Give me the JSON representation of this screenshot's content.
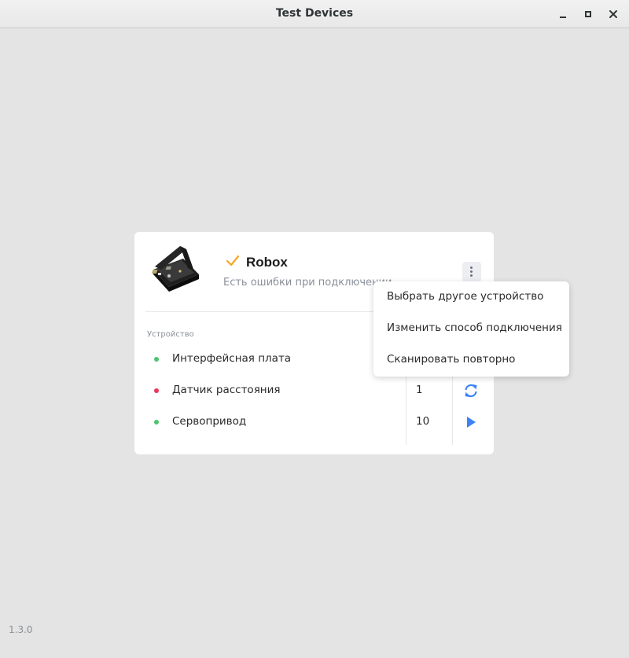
{
  "window": {
    "title": "Test Devices",
    "controls": [
      "minimize-icon",
      "maximize-icon",
      "close-icon"
    ]
  },
  "device": {
    "name": "Robox",
    "status": "Есть ошибки при подключении",
    "status_icon": "check-icon",
    "accent_color": "#f5a524"
  },
  "table": {
    "header": "Устройство",
    "rows": [
      {
        "name": "Интерфейсная плата",
        "status_color": "#4cc46b",
        "value": "",
        "action_icon": ""
      },
      {
        "name": "Датчик расстояния",
        "status_color": "#e8385a",
        "value": "1",
        "action_icon": "refresh-icon"
      },
      {
        "name": "Сервопривод",
        "status_color": "#4cc46b",
        "value": "10",
        "action_icon": "play-icon"
      }
    ],
    "action_color": "#3b82f6"
  },
  "menu": {
    "items": [
      "Выбрать другое устройство",
      "Изменить способ подключения",
      "Сканировать повторно"
    ]
  },
  "footer": {
    "version": "1.3.0"
  }
}
